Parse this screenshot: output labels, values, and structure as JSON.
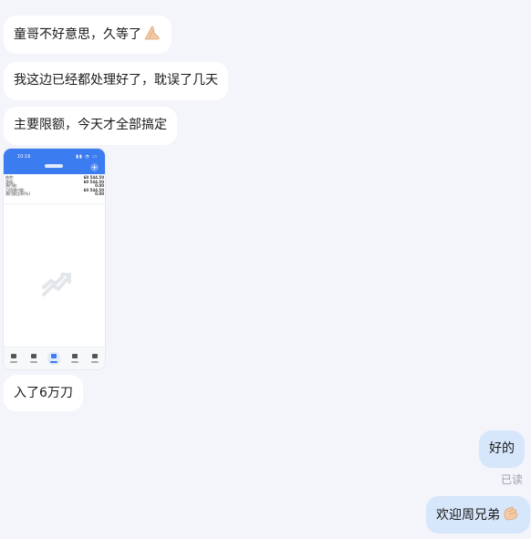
{
  "messages": [
    {
      "text": "童哥不好意思，久等了",
      "emoji": "hands-pressed-icon"
    },
    {
      "text": "我这边已经都处理好了，耽误了几天"
    },
    {
      "text": "主要限额，今天才全部搞定"
    },
    {
      "text": "入了6万刀"
    }
  ],
  "screenshot": {
    "time": "10:16",
    "rows": [
      {
        "label": "结余:",
        "value": "60 544.50"
      },
      {
        "label": "净值:",
        "value": "60 544.50"
      },
      {
        "label": "预付款:",
        "value": "0.00"
      },
      {
        "label": "可用预付款:",
        "value": "60 544.50"
      },
      {
        "label": "预付款比率(%)",
        "value": "0.00"
      }
    ]
  },
  "outgoing": [
    {
      "text": "好的",
      "status": "已读"
    },
    {
      "text": "欢迎周兄弟",
      "emoji": "clapping-hands-icon"
    }
  ],
  "colors": {
    "background": "#f3f5fa",
    "incoming_bubble": "#ffffff",
    "outgoing_bubble": "#d6e6fb",
    "phone_header": "#3b7cf0"
  }
}
